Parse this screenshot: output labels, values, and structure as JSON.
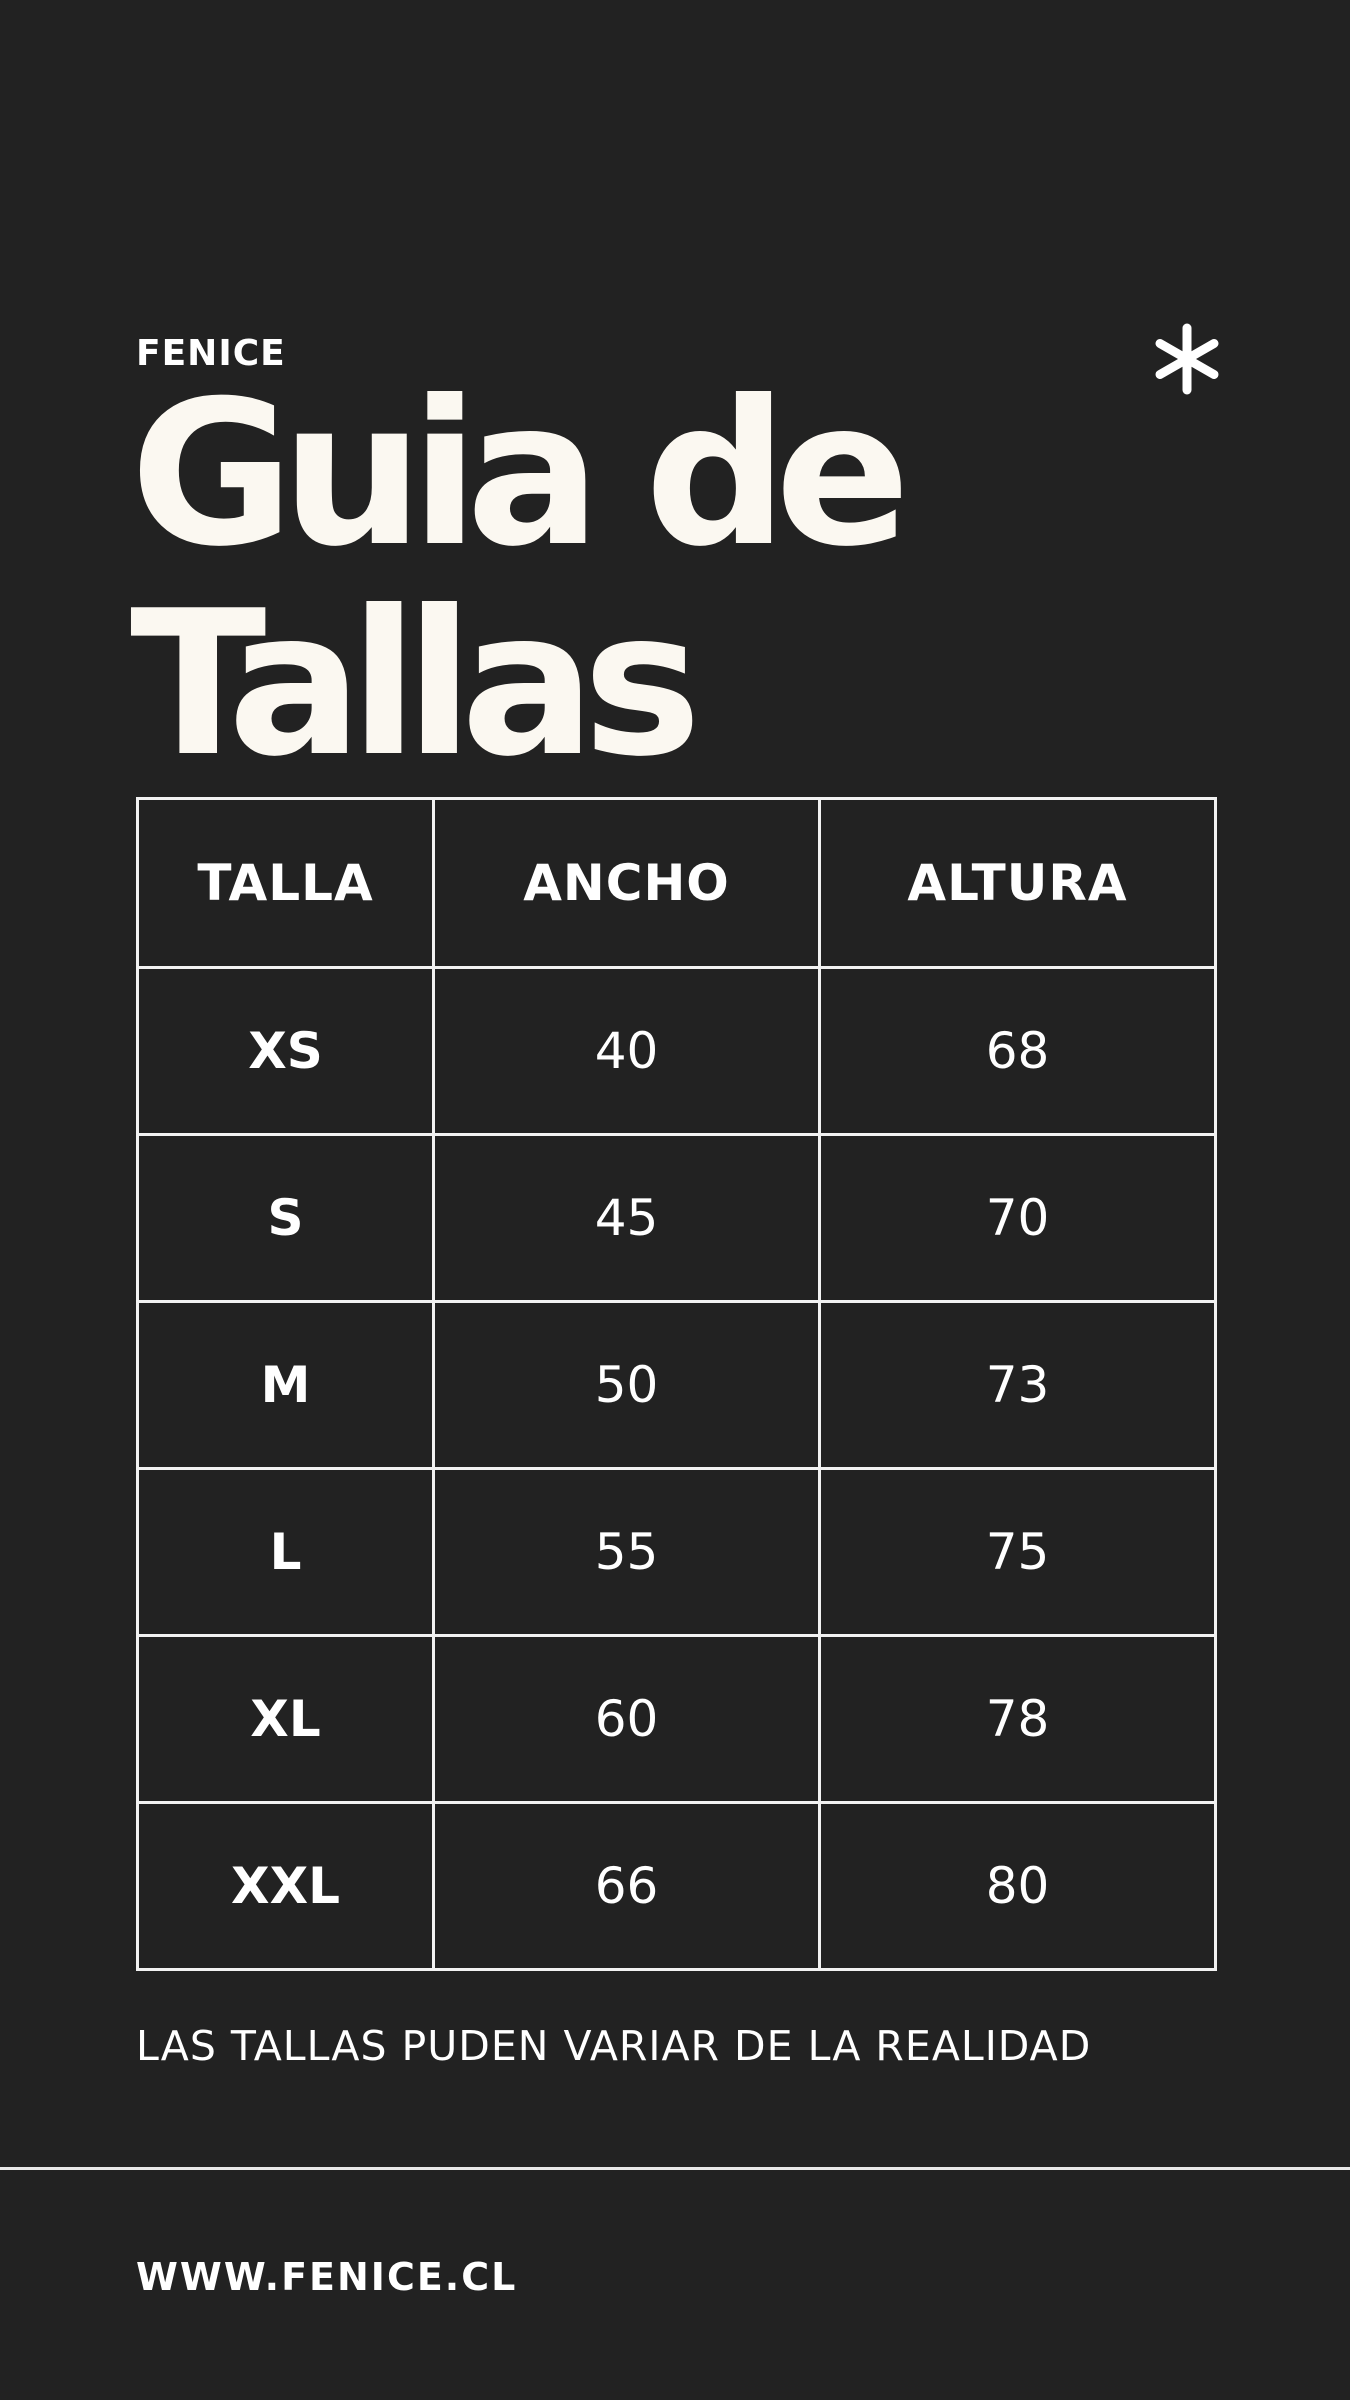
{
  "brand": "FENICE",
  "title": {
    "line1": "Guia de",
    "line2": "Tallas"
  },
  "icons": {
    "decoration": "asterisk-icon"
  },
  "table": {
    "headers": [
      "TALLA",
      "ANCHO",
      "ALTURA"
    ],
    "rows": [
      {
        "size": "XS",
        "ancho": "40",
        "altura": "68"
      },
      {
        "size": "S",
        "ancho": "45",
        "altura": "70"
      },
      {
        "size": "M",
        "ancho": "50",
        "altura": "73"
      },
      {
        "size": "L",
        "ancho": "55",
        "altura": "75"
      },
      {
        "size": "XL",
        "ancho": "60",
        "altura": "78"
      },
      {
        "size": "XXL",
        "ancho": "66",
        "altura": "80"
      }
    ]
  },
  "note": "LAS TALLAS PUDEN VARIAR DE LA REALIDAD",
  "website": "WWW.FENICE.CL",
  "colors": {
    "background": "#222222",
    "text": "#ffffff",
    "title": "#fbf8f1"
  }
}
